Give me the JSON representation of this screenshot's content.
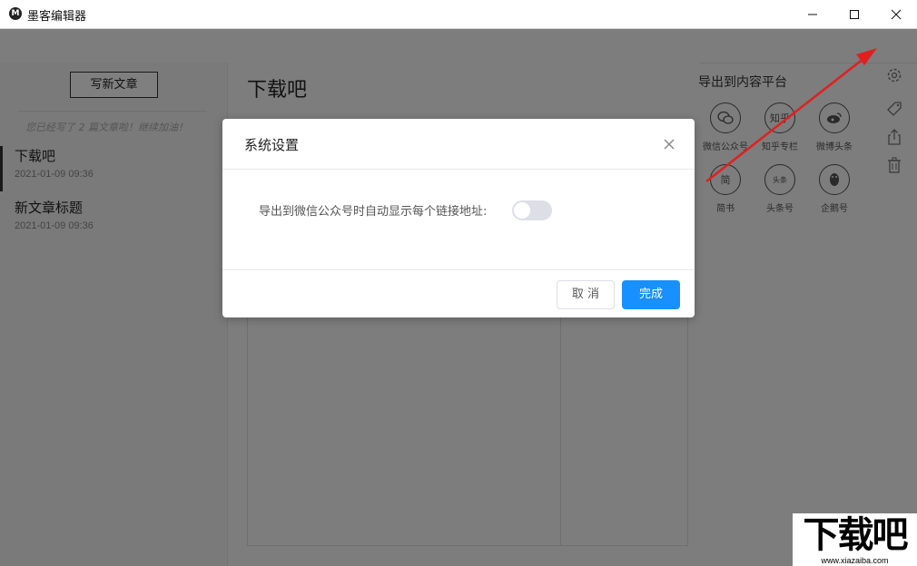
{
  "window": {
    "title": "墨客编辑器",
    "logo_glyph": "M"
  },
  "sidebar": {
    "new_article_label": "写新文章",
    "hint": "您已经写了 2 篇文章啦！继续加油！",
    "articles": [
      {
        "title": "下载吧",
        "date": "2021-01-09 09:36",
        "active": true
      },
      {
        "title": "新文章标题",
        "date": "2021-01-09 09:36",
        "active": false
      }
    ]
  },
  "editor": {
    "title": "下载吧"
  },
  "export": {
    "title": "导出到内容平台",
    "platforms": [
      {
        "label": "微信公众号",
        "icon": "wechat-icon",
        "glyph": ""
      },
      {
        "label": "知乎专栏",
        "icon": "zhihu-icon",
        "glyph": "知乎"
      },
      {
        "label": "微博头条",
        "icon": "weibo-icon",
        "glyph": ""
      },
      {
        "label": "简书",
        "icon": "jianshu-icon",
        "glyph": "简"
      },
      {
        "label": "头条号",
        "icon": "toutiao-icon",
        "glyph": "头条"
      },
      {
        "label": "企鹅号",
        "icon": "penguin-icon",
        "glyph": ""
      }
    ]
  },
  "dialog": {
    "title": "系统设置",
    "option_label": "导出到微信公众号时自动显示每个链接地址:",
    "option_enabled": false,
    "cancel_label": "取 消",
    "confirm_label": "完成"
  },
  "colors": {
    "accent": "#1890ff",
    "annotation_arrow": "#e02020"
  },
  "watermark": {
    "text": "下载吧",
    "url": "www.xiazaiba.com"
  }
}
